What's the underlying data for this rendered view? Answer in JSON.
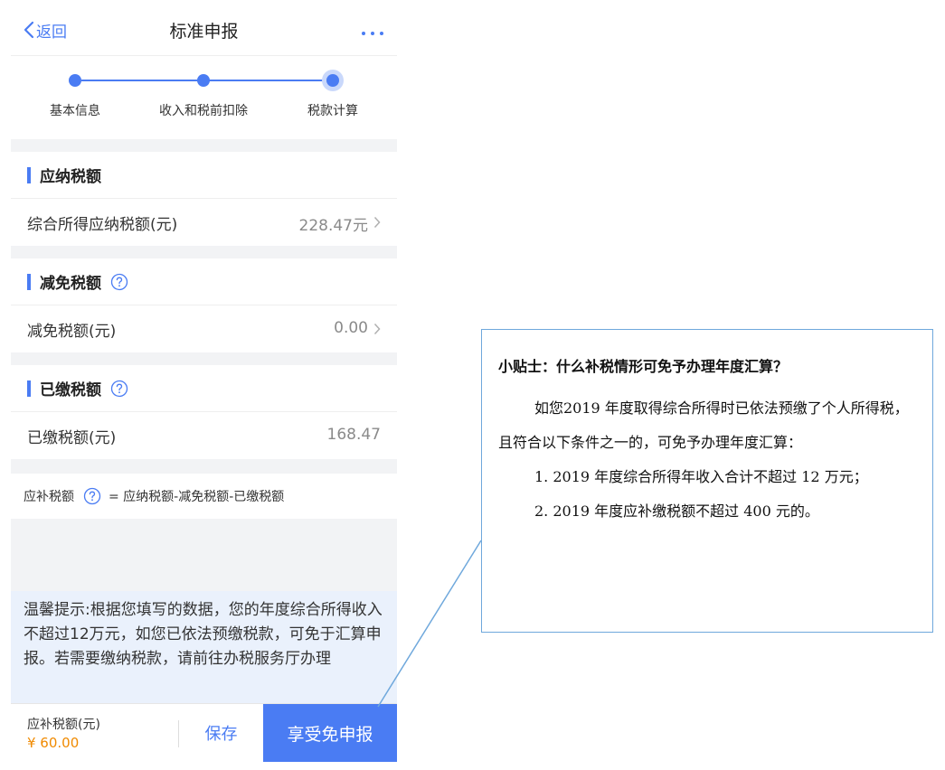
{
  "colors": {
    "accent": "#4a7cf3",
    "amount": "#f08a00",
    "tip_bg": "#eaf1fc",
    "callout_border": "#6fa8dc"
  },
  "navbar": {
    "back_label": "返回",
    "back_icon": "chevron-left-icon",
    "title": "标准申报",
    "more_icon": "more-dots-icon"
  },
  "steps": [
    {
      "label": "基本信息",
      "state": "done"
    },
    {
      "label": "收入和税前扣除",
      "state": "done"
    },
    {
      "label": "税款计算",
      "state": "current"
    }
  ],
  "sections": {
    "payable": {
      "title": "应纳税额",
      "row_label": "综合所得应纳税额(元)",
      "row_value": "228.47元"
    },
    "relief": {
      "title": "减免税额",
      "row_label": "减免税额(元)",
      "row_value": "0.00"
    },
    "paid": {
      "title": "已缴税额",
      "row_label": "已缴税额(元)",
      "row_value": "168.47"
    }
  },
  "formula": {
    "label": "应补税额",
    "expression": "= 应纳税额-减免税额-已缴税额"
  },
  "tip": {
    "text": "温馨提示:根据您填写的数据，您的年度综合所得收入不超过12万元，如您已依法预缴税款，可免于汇算申报。若需要缴纳税款，请前往办税服务厅办理"
  },
  "bottom_bar": {
    "label": "应补税额(元)",
    "amount": "¥ 60.00",
    "save_label": "保存",
    "primary_label": "享受免申报"
  },
  "callout": {
    "title": "小贴士：什么补税情形可免予办理年度汇算？",
    "paragraph": "如您2019 年度取得综合所得时已依法预缴了个人所得税，且符合以下条件之一的，可免予办理年度汇算：",
    "items": [
      "1. 2019 年度综合所得年收入合计不超过  12 万元；",
      "2. 2019 年度应补缴税额不超过  400 元的。"
    ]
  }
}
